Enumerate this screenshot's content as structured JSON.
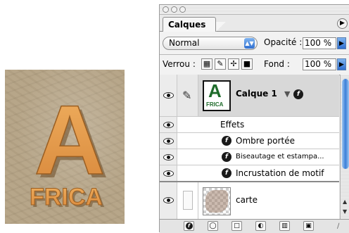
{
  "artwork": {
    "big_letter": "A",
    "word": "FRICA"
  },
  "palette": {
    "tab_label": "Calques",
    "blend_mode": "Normal",
    "opacity_label": "Opacité :",
    "opacity_value": "100 %",
    "lock_label": "Verrou :",
    "fill_label": "Fond :",
    "fill_value": "100 %",
    "layers": [
      {
        "name": "Calque 1",
        "thumb_letter": "A",
        "thumb_word": "FRICA"
      },
      {
        "name": "carte"
      }
    ],
    "effects_label": "Effets",
    "effects": [
      "Ombre portée",
      "Biseautage et estampa...",
      "Incrustation de motif"
    ]
  },
  "colors": {
    "accent_blue": "#3b7fd8",
    "letter_orange": "#e39a45",
    "thumb_green": "#1e6b2a"
  }
}
